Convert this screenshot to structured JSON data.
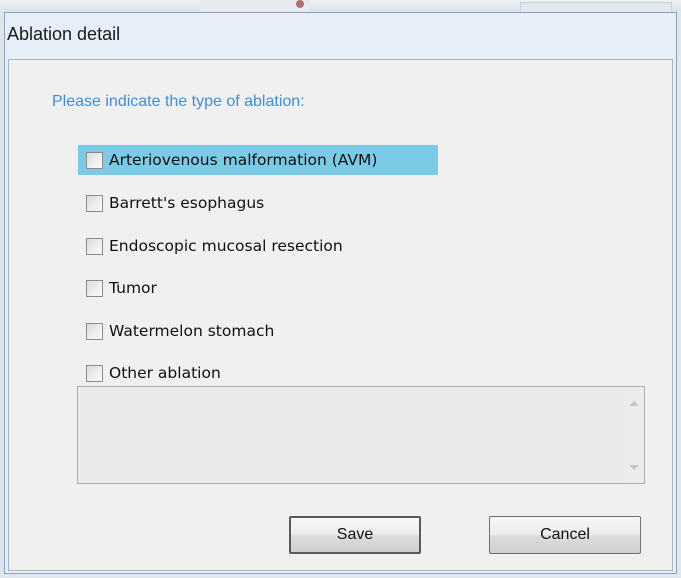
{
  "dialog": {
    "title": "Ablation detail",
    "prompt": "Please indicate the type of ablation:",
    "options": [
      {
        "label": "Arteriovenous malformation (AVM)",
        "checked": false,
        "highlighted": true
      },
      {
        "label": "Barrett's esophagus",
        "checked": false
      },
      {
        "label": "Endoscopic mucosal resection",
        "checked": false
      },
      {
        "label": "Tumor",
        "checked": false
      },
      {
        "label": "Watermelon stomach",
        "checked": false
      },
      {
        "label": "Other ablation",
        "checked": false
      }
    ],
    "other_text": "",
    "buttons": {
      "save_label": "Save",
      "cancel_label": "Cancel"
    }
  }
}
